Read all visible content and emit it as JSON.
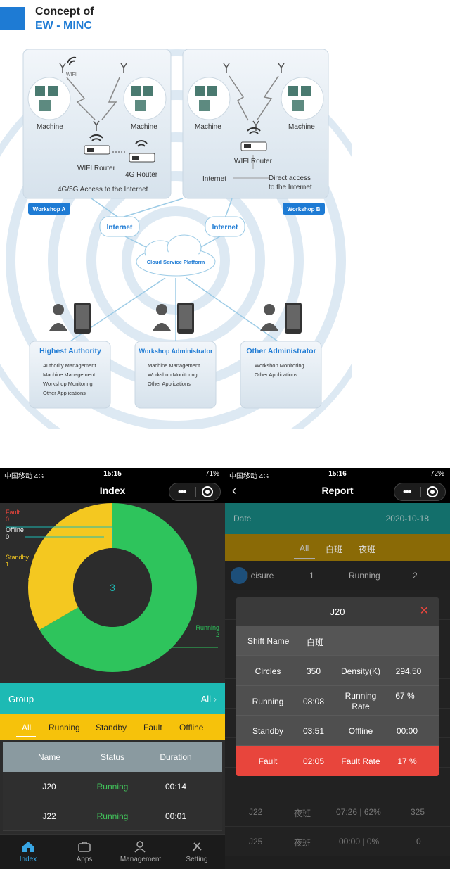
{
  "header": {
    "line1": "Concept of",
    "line2": "EW - MINC"
  },
  "concept": {
    "workshop_a": {
      "badge": "Workshop A",
      "wifi_label": "WIFI",
      "machine_left": "Machine",
      "machine_right": "Machine",
      "router": "WIFI Router",
      "router_4g": "4G Router",
      "access": "4G/5G Access to the Internet"
    },
    "workshop_b": {
      "badge": "Workshop B",
      "machine_left": "Machine",
      "machine_right": "Machine",
      "router": "WIFI Router",
      "internet": "Internet",
      "direct1": "Direct access",
      "direct2": "to the Internet"
    },
    "internet_left": "Internet",
    "internet_right": "Internet",
    "cloud": "Cloud Service Platform",
    "roles": [
      {
        "title": "Highest Authority",
        "items": [
          "Authority Management",
          "Machine Management",
          "Workshop Monitoring",
          "Other Applications"
        ]
      },
      {
        "title": "Workshop Administrator",
        "items": [
          "Machine Management",
          "Workshop Monitoring",
          "Other Applications"
        ]
      },
      {
        "title": "Other Administrator",
        "items": [
          "Workshop Monitoring",
          "Other Applications"
        ]
      }
    ]
  },
  "phone_index": {
    "status": {
      "carrier": "中国移动 4G",
      "time": "15:15",
      "right": "71%"
    },
    "title": "Index",
    "chart_data": {
      "type": "pie",
      "categories": [
        "Running",
        "Standby",
        "Fault",
        "Offline"
      ],
      "values": [
        2,
        1,
        0,
        0
      ],
      "center_label": "3",
      "colors": [
        "#2ec45c",
        "#f4c820",
        "#e8453c",
        "#ffffff"
      ]
    },
    "labels": {
      "fault": "Fault",
      "fault_v": "0",
      "offline": "Offline",
      "offline_v": "0",
      "standby": "Standby",
      "standby_v": "1",
      "running": "Running",
      "running_v": "2"
    },
    "group": {
      "label": "Group",
      "value": "All"
    },
    "filters": [
      "All",
      "Running",
      "Standby",
      "Fault",
      "Offline"
    ],
    "table": {
      "headers": [
        "Name",
        "Status",
        "Duration"
      ],
      "rows": [
        [
          "J20",
          "Running",
          "00:14"
        ],
        [
          "J22",
          "Running",
          "00:01"
        ]
      ]
    },
    "tabs": [
      "Index",
      "Apps",
      "Management",
      "Setting"
    ]
  },
  "phone_report": {
    "status": {
      "carrier": "中国移动 4G",
      "time": "15:16",
      "right": "72%"
    },
    "title": "Report",
    "date": {
      "label": "Date",
      "value": "2020-10-18"
    },
    "shifts": [
      "All",
      "白班",
      "夜班"
    ],
    "leisure": {
      "label": "Leisure",
      "v1": "1",
      "running": "Running",
      "v2": "2"
    },
    "bg_rows": [
      [
        "J22",
        "夜班",
        "07:26 | 62%",
        "325"
      ],
      [
        "J25",
        "夜班",
        "00:00 | 0%",
        "0"
      ]
    ],
    "modal": {
      "title": "J20",
      "shift_label": "Shift Name",
      "shift_value": "白班",
      "rows": [
        [
          "Circles",
          "350",
          "Density(K)",
          "294.50"
        ],
        [
          "Running",
          "08:08",
          "Running Rate",
          "67 %"
        ],
        [
          "Standby",
          "03:51",
          "Offline",
          "00:00"
        ],
        [
          "Fault",
          "02:05",
          "Fault Rate",
          "17 %"
        ]
      ]
    }
  }
}
